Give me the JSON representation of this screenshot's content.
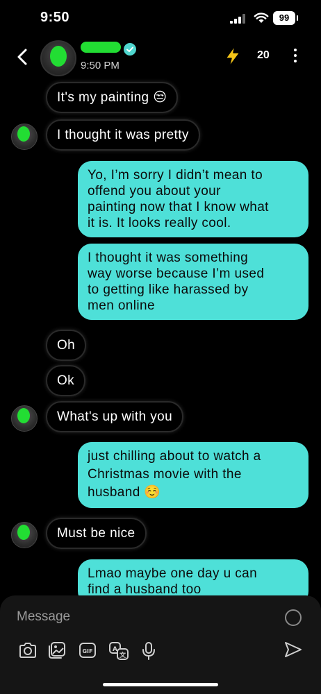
{
  "status_bar": {
    "time": "9:50",
    "battery": "99"
  },
  "header": {
    "timestamp": "9:50 PM",
    "streak_count": "20"
  },
  "messages": [
    {
      "side": "received",
      "text": "It's my painting 😒"
    },
    {
      "side": "received",
      "text": "I thought it was pretty"
    },
    {
      "side": "sent",
      "lines": [
        "Yo, I’m sorry I didn’t mean to",
        "offend you about your",
        "painting now that I know what",
        "it is. It looks really cool."
      ]
    },
    {
      "side": "sent",
      "lines": [
        "I thought it was something",
        "way worse because I’m used",
        "to getting like harassed by",
        "men online"
      ]
    },
    {
      "side": "received",
      "text": "Oh"
    },
    {
      "side": "received",
      "text": "Ok"
    },
    {
      "side": "received",
      "text": "What's up with you"
    },
    {
      "side": "sent",
      "lines": [
        "just chilling about to watch a",
        "Christmas movie with the",
        "husband ☺️"
      ]
    },
    {
      "side": "received",
      "text": "Must be nice"
    },
    {
      "side": "sent",
      "lines": [
        "Lmao maybe one day u can",
        "find a husband too"
      ]
    }
  ],
  "composer": {
    "placeholder": "Message",
    "icons": [
      "camera-icon",
      "gallery-icon",
      "gif-icon",
      "translate-icon",
      "microphone-icon",
      "send-icon"
    ]
  },
  "colors": {
    "sent_bubble": "#4ee0d8",
    "background": "#000000",
    "accent_green": "#22dd33",
    "bolt": "#f5c518"
  }
}
